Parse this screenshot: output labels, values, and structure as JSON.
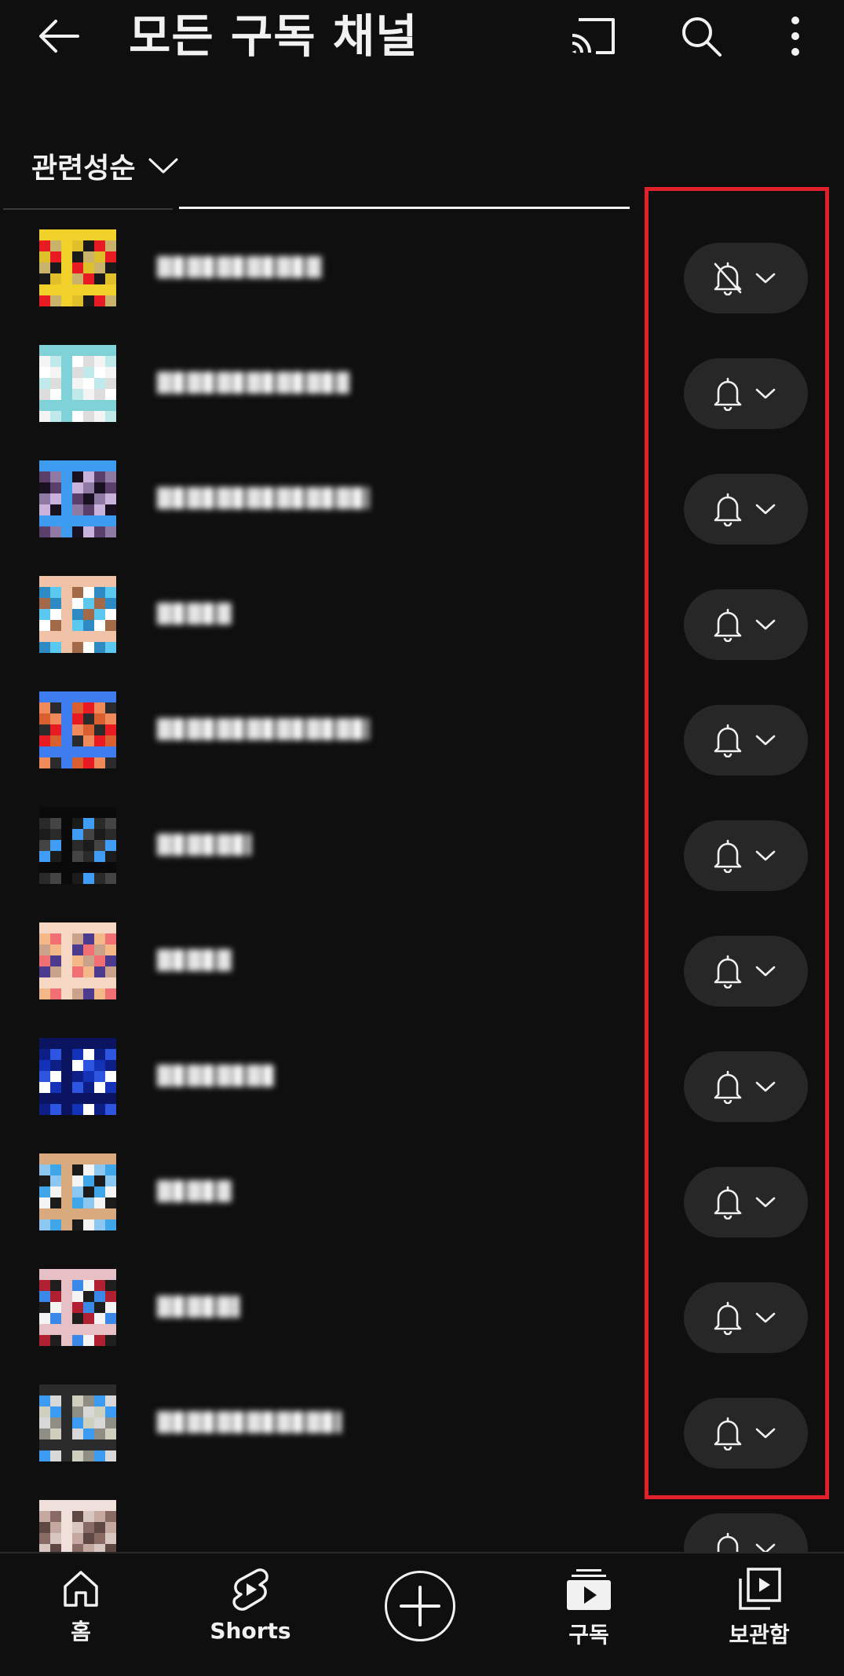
{
  "header": {
    "title": "모든 구독 채널",
    "back_icon": "arrow-left-icon",
    "cast_icon": "cast-icon",
    "search_icon": "search-icon",
    "more_icon": "more-vert-icon"
  },
  "sort": {
    "label": "관련성순",
    "icon": "chevron-down-icon"
  },
  "channels": [
    {
      "name": "",
      "notification": "off"
    },
    {
      "name": "",
      "notification": "on"
    },
    {
      "name": "",
      "notification": "on"
    },
    {
      "name": "",
      "notification": "on"
    },
    {
      "name": "",
      "notification": "on"
    },
    {
      "name": "",
      "notification": "on"
    },
    {
      "name": "",
      "notification": "on"
    },
    {
      "name": "",
      "notification": "on"
    },
    {
      "name": "",
      "notification": "on"
    },
    {
      "name": "",
      "notification": "on"
    },
    {
      "name": "",
      "notification": "on"
    },
    {
      "name": "",
      "notification": "on"
    }
  ],
  "nav": {
    "home": "홈",
    "shorts": "Shorts",
    "create_icon": "plus-icon",
    "subscriptions": "구독",
    "library": "보관함"
  },
  "colors": {
    "background": "#0f0f0f",
    "pill": "#272727",
    "highlight": "#e0202a",
    "text": "#f1f1f1"
  }
}
